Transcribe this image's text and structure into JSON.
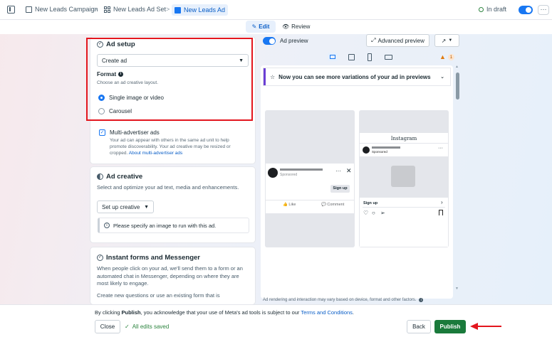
{
  "topbar": {
    "breadcrumb": [
      "New Leads Campaign",
      "New Leads Ad Set",
      "New Leads Ad"
    ],
    "status": "In draft"
  },
  "subbar": {
    "edit_label": "Edit",
    "review_label": "Review"
  },
  "ad_setup": {
    "title": "Ad setup",
    "select_value": "Create ad",
    "format_label": "Format",
    "format_hint": "Choose an ad creative layout.",
    "options": [
      "Single image or video",
      "Carousel"
    ],
    "selected_option": "Single image or video"
  },
  "multi_advertiser": {
    "label": "Multi-advertiser ads",
    "desc_1": "Your ad can appear with others in the same ad unit to help",
    "desc_2": "promote discoverability. Your ad creative may be resized or",
    "desc_3": "cropped.",
    "link": "About multi-advertiser ads",
    "checked": true
  },
  "ad_creative": {
    "title": "Ad creative",
    "desc": "Select and optimize your ad text, media and enhancements.",
    "setup_button": "Set up creative",
    "notice": "Please specify an image to run with this ad."
  },
  "instant_forms": {
    "title": "Instant forms and Messenger",
    "desc_1": "When people click on your ad, we'll send them to a form or an",
    "desc_2": "automated chat in Messenger, depending on where they are",
    "desc_3": "most likely to engage.",
    "desc_4": "Create new questions or use an existing form that is"
  },
  "preview": {
    "toggle_label": "Ad preview",
    "advanced_button": "Advanced preview",
    "warning_count": "1",
    "banner": "Now you can see more variations of your ad in previews",
    "fb_card": {
      "sponsored": "Sponsored",
      "cta": "Sign up",
      "like": "Like",
      "comment": "Comment"
    },
    "ig_card": {
      "brand": "Instagram",
      "sponsored": "Sponsored",
      "cta": "Sign up"
    },
    "footer": "Ad rendering and interaction may vary based on device, format and other factors."
  },
  "footer": {
    "consent_prefix": "By clicking ",
    "consent_bold": "Publish",
    "consent_middle": ", you acknowledge that your use of Meta's ad tools is subject to our ",
    "consent_link": "Terms and Conditions",
    "consent_end": ".",
    "close_label": "Close",
    "saved_label": "All edits saved",
    "back_label": "Back",
    "publish_label": "Publish"
  },
  "colors": {
    "accent": "#1877f2",
    "publish": "#1a7a3b",
    "highlight": "#e3161e"
  }
}
